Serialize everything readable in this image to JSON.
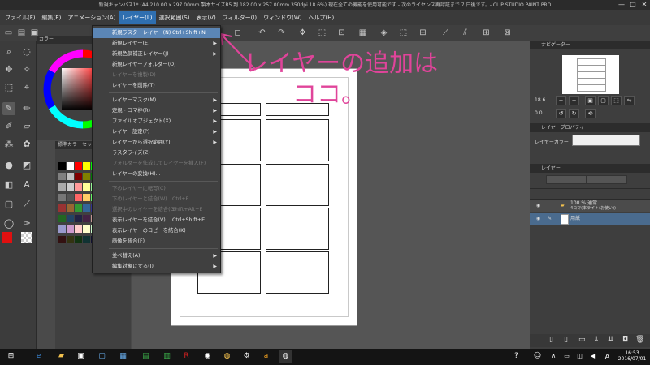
{
  "window": {
    "title": "新規キャンバス1* (A4 210.00 x 297.00mm 製本サイズB5 判 182.00 x 257.00mm 350dpi 18.6%) 現在全ての機能を使用可能です - 次のライセンス再認証まで 7 日後です。- CLIP STUDIO PAINT PRO",
    "minimize": "—",
    "maximize": "□",
    "close": "✕"
  },
  "menubar": {
    "items": [
      "ファイル(F)",
      "編集(E)",
      "アニメーション(A)",
      "レイヤー(L)",
      "選択範囲(S)",
      "表示(V)",
      "フィルター(I)",
      "ウィンドウ(W)",
      "ヘルプ(H)"
    ],
    "active_index": 3
  },
  "layer_menu": {
    "items": [
      {
        "label": "新規ラスターレイヤー(N)",
        "shortcut": "Ctrl+Shift+N",
        "submenu": false,
        "disabled": false,
        "highlight": true
      },
      {
        "label": "新規レイヤー(E)",
        "shortcut": "",
        "submenu": true,
        "disabled": false
      },
      {
        "label": "新規色調補正レイヤー(J)",
        "shortcut": "",
        "submenu": true,
        "disabled": false
      },
      {
        "label": "新規レイヤーフォルダー(O)",
        "shortcut": "",
        "submenu": false,
        "disabled": false
      },
      {
        "label": "レイヤーを複製(D)",
        "shortcut": "",
        "submenu": false,
        "disabled": true
      },
      {
        "label": "レイヤーを削除(T)",
        "shortcut": "",
        "submenu": false,
        "disabled": false
      },
      {
        "label": "レイヤーマスク(M)",
        "shortcut": "",
        "submenu": true,
        "disabled": false
      },
      {
        "label": "定規・コマ枠(R)",
        "shortcut": "",
        "submenu": true,
        "disabled": false
      },
      {
        "label": "ファイルオブジェクト(X)",
        "shortcut": "",
        "submenu": true,
        "disabled": false
      },
      {
        "label": "レイヤー設定(P)",
        "shortcut": "",
        "submenu": true,
        "disabled": false
      },
      {
        "label": "レイヤーから選択範囲(Y)",
        "shortcut": "",
        "submenu": true,
        "disabled": false
      },
      {
        "label": "ラスタライズ(Z)",
        "shortcut": "",
        "submenu": false,
        "disabled": false
      },
      {
        "label": "フォルダーを作成してレイヤーを挿入(F)",
        "shortcut": "",
        "submenu": false,
        "disabled": true
      },
      {
        "label": "レイヤーの変換(H)...",
        "shortcut": "",
        "submenu": false,
        "disabled": false
      },
      {
        "label": "下のレイヤーに転写(C)",
        "shortcut": "",
        "submenu": false,
        "disabled": true
      },
      {
        "label": "下のレイヤーと結合(W)",
        "shortcut": "Ctrl+E",
        "submenu": false,
        "disabled": true
      },
      {
        "label": "選択中のレイヤーを結合(G)",
        "shortcut": "Shift+Alt+E",
        "submenu": false,
        "disabled": true
      },
      {
        "label": "表示レイヤーを結合(V)",
        "shortcut": "Ctrl+Shift+E",
        "submenu": false,
        "disabled": false
      },
      {
        "label": "表示レイヤーのコピーを結合(K)",
        "shortcut": "",
        "submenu": false,
        "disabled": false
      },
      {
        "label": "画像を統合(F)",
        "shortcut": "",
        "submenu": false,
        "disabled": false
      },
      {
        "label": "並べ替え(A)",
        "shortcut": "",
        "submenu": true,
        "disabled": false
      },
      {
        "label": "編集対象にする(I)",
        "shortcut": "",
        "submenu": true,
        "disabled": false
      }
    ]
  },
  "annotation": {
    "line1": "レイヤーの追加は",
    "line2": "ココ。",
    "color": "#e0449a"
  },
  "left_panels": {
    "color_panel_label": "カラー",
    "palette_label": "標準カラーセット"
  },
  "right_panels": {
    "navigator_label": "ナビゲーター",
    "zoom_value": "18.6",
    "rotation_value": "0.0",
    "layer_property_label": "レイヤープロパティ",
    "layer_color_label": "レイヤーカラー",
    "layer_panel_label": "レイヤー",
    "layers": [
      {
        "name": "100 % 通常",
        "sub": "4コマ(本ライト(お使い))",
        "type": "folder"
      },
      {
        "name": "用紙",
        "sub": "",
        "type": "paper"
      }
    ]
  },
  "taskbar": {
    "time": "16:53",
    "date": "2016/07/01",
    "ime": "A"
  },
  "colors": {
    "accent": "#2f6fb0",
    "menu_highlight": "#5b86b6",
    "annotation": "#e0449a"
  }
}
